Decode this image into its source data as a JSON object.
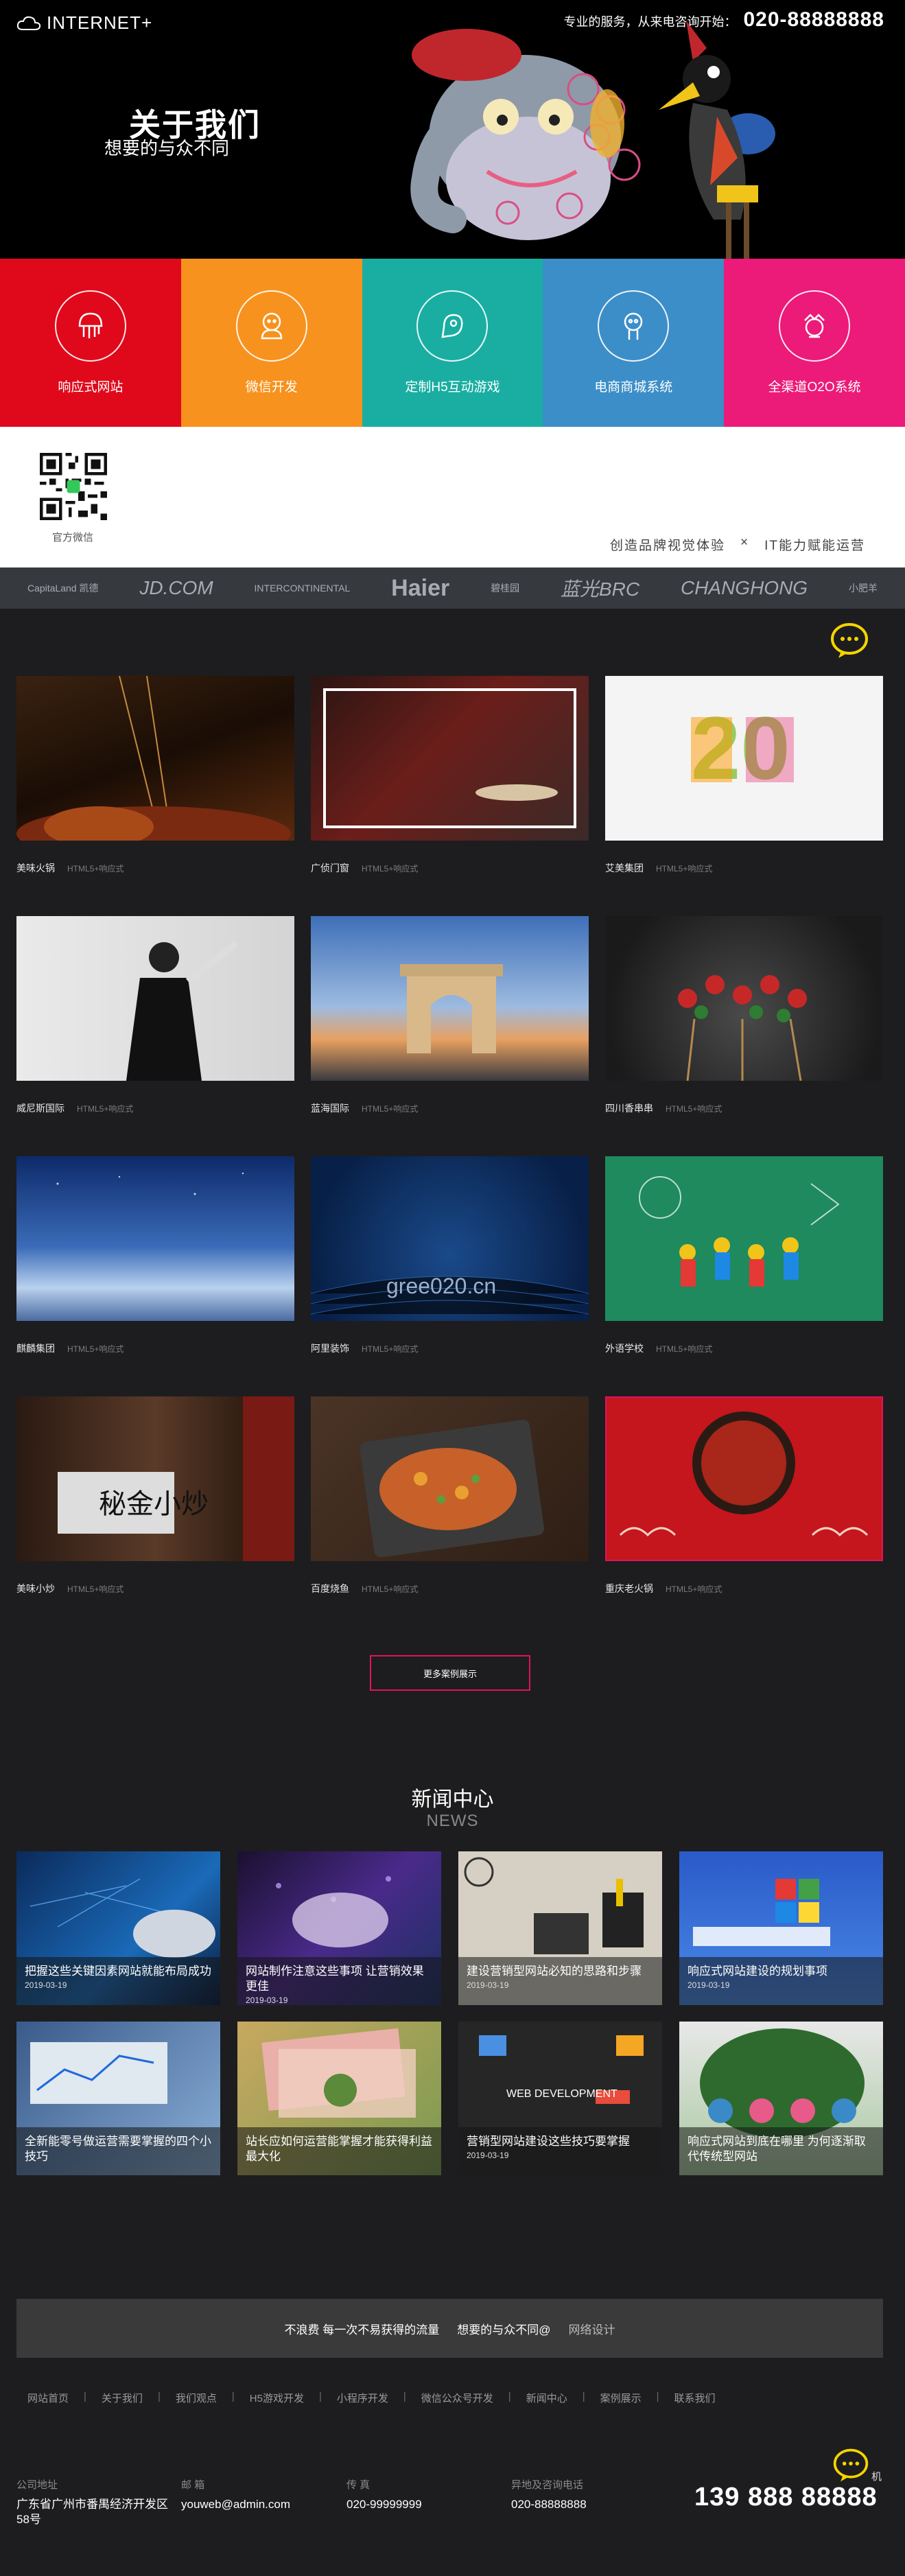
{
  "header": {
    "logo_text": "INTERNET+",
    "hotline_label": "专业的服务，从来电咨询开始：",
    "hotline_number": "020-88888888"
  },
  "hero": {
    "title": "关于我们",
    "subtitle": "想要的与众不同"
  },
  "services": [
    {
      "label": "响应式网站",
      "icon": "jellyfish-icon",
      "color": "#e0091b"
    },
    {
      "label": "微信开发",
      "icon": "wechat-mascot-icon",
      "color": "#f7921e"
    },
    {
      "label": "定制H5互动游戏",
      "icon": "game-character-icon",
      "color": "#1aaea2"
    },
    {
      "label": "电商商城系统",
      "icon": "mall-character-icon",
      "color": "#3c8ec8"
    },
    {
      "label": "全渠道O2O系统",
      "icon": "o2o-character-icon",
      "color": "#ec1a78"
    }
  ],
  "qr": {
    "caption": "官方微信"
  },
  "slogan": {
    "left": "创造品牌视觉体验",
    "sep": "×",
    "right": "IT能力赋能运营"
  },
  "partners": [
    {
      "name": "CapitaLand 凯德",
      "size": "small"
    },
    {
      "name": "JD.COM",
      "size": "mid"
    },
    {
      "name": "INTERCONTINENTAL",
      "size": "small"
    },
    {
      "name": "Haier",
      "size": "big"
    },
    {
      "name": "碧桂园",
      "size": "small"
    },
    {
      "name": "蓝光BRC",
      "size": "mid"
    },
    {
      "name": "CHANGHONG",
      "size": "mid"
    },
    {
      "name": "小肥羊",
      "size": "small"
    }
  ],
  "cases": {
    "items": [
      {
        "name": "美味火锅",
        "tag": "HTML5+响应式"
      },
      {
        "name": "广侦门窗",
        "tag": "HTML5+响应式"
      },
      {
        "name": "艾美集团",
        "tag": "HTML5+响应式"
      },
      {
        "name": "威尼斯国际",
        "tag": "HTML5+响应式"
      },
      {
        "name": "蓝海国际",
        "tag": "HTML5+响应式"
      },
      {
        "name": "四川香串串",
        "tag": "HTML5+响应式"
      },
      {
        "name": "麒麟集团",
        "tag": "HTML5+响应式"
      },
      {
        "name": "阿里装饰",
        "tag": "HTML5+响应式"
      },
      {
        "name": "外语学校",
        "tag": "HTML5+响应式"
      },
      {
        "name": "美味小炒",
        "tag": "HTML5+响应式"
      },
      {
        "name": "百度烧鱼",
        "tag": "HTML5+响应式"
      },
      {
        "name": "重庆老火锅",
        "tag": "HTML5+响应式"
      }
    ],
    "more_label": "更多案例展示",
    "watermark": "gree020.cn",
    "poster_chars": "秘金小炒"
  },
  "news": {
    "title": "新闻中心",
    "subtitle": "NEWS",
    "items": [
      {
        "title": "把握这些关键因素网站就能布局成功",
        "date": "2019-03-19"
      },
      {
        "title": "网站制作注意这些事项 让营销效果更佳",
        "date": "2019-03-19"
      },
      {
        "title": "建设营销型网站必知的思路和步骤",
        "date": "2019-03-19"
      },
      {
        "title": "响应式网站建设的规划事项",
        "date": "2019-03-19"
      },
      {
        "title": "全新能零号做运营需要掌握的四个小技巧",
        "date": ""
      },
      {
        "title": "站长应如何运营能掌握才能获得利益最大化",
        "date": ""
      },
      {
        "title": "营销型网站建设这些技巧要掌握",
        "date": "2019-03-19"
      },
      {
        "title": "响应式网站到底在哪里 为何逐渐取代传统型网站",
        "date": ""
      }
    ]
  },
  "footer": {
    "banner": {
      "a": "不浪费 每一次不易获得的流量",
      "b": "想要的与众不同@",
      "c": "网络设计"
    },
    "nav": [
      "网站首页",
      "关于我们",
      "我们观点",
      "H5游戏开发",
      "小程序开发",
      "微信公众号开发",
      "新闻中心",
      "案例展示",
      "联系我们"
    ],
    "contacts": [
      {
        "label": "公司地址",
        "value": "广东省广州市番禺经济开发区58号"
      },
      {
        "label": "邮 箱",
        "value": "youweb@admin.com"
      },
      {
        "label": "传 真",
        "value": "020-99999999"
      },
      {
        "label": "异地及咨询电话",
        "value": "020-88888888"
      }
    ],
    "big_phone": "139 888 88888",
    "chat_text": "机"
  }
}
